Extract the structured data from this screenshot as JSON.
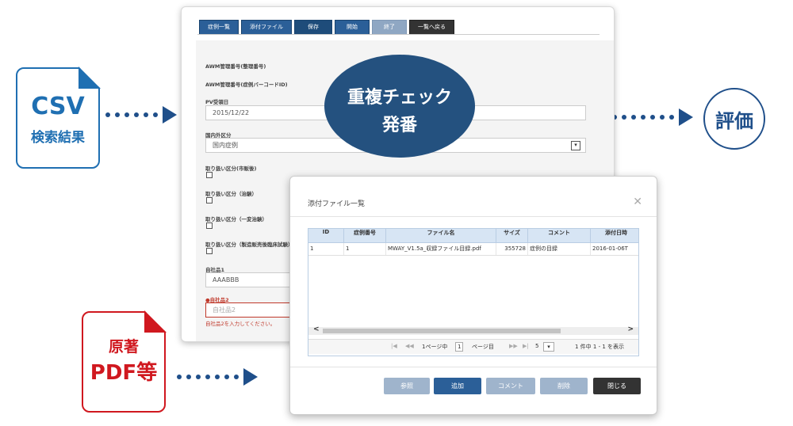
{
  "csv_doc": {
    "title": "CSV",
    "subtitle": "検索結果"
  },
  "pdf_doc": {
    "line1": "原著",
    "line2": "PDF等"
  },
  "eval_label": "評価",
  "ellipse": {
    "line1": "重複チェック",
    "line2": "発番"
  },
  "colors": {
    "brand_blue": "#1f4f8a",
    "pdf_red": "#d0181f",
    "ellipse": "#24517f"
  },
  "main_window": {
    "tabs": [
      "症例一覧",
      "添付ファイル",
      "保存",
      "開始",
      "終了",
      "一覧へ戻る"
    ],
    "fields": {
      "awm_mgmt_label": "AWM管理番号(整理番号)",
      "awm_barcode_label": "AWM管理番号(症例バーコードID)",
      "pv_date_label": "PV受領日",
      "pv_date_value": "2015/12/22",
      "domestic_label": "国内外区分",
      "domestic_value": "国内症例",
      "handling1_label": "取り扱い区分(市販後)",
      "handling2_label": "取り扱い区分（治験）",
      "handling3_label": "取り扱い区分（一変治験）",
      "handling4_label": "取り扱い区分（製造販売後臨床試験）",
      "product1_label": "自社品1",
      "product1_value": "AAABBB",
      "product2_label": "自社品2",
      "product2_placeholder": "自社品2",
      "product2_error": "自社品2を入力してください。"
    }
  },
  "dialog": {
    "title": "添付ファイル一覧",
    "columns": [
      "ID",
      "症例番号",
      "ファイル名",
      "サイズ",
      "コメント",
      "添付日時"
    ],
    "rows": [
      [
        "1",
        "1",
        "MWAY_V1.5a_収録ファイル目録.pdf",
        "355728",
        "症例の目録",
        "2016-01-06T"
      ]
    ],
    "pager": {
      "page_of": "1ページ中",
      "page_num": "1",
      "page_suffix": "ページ目",
      "per_page": "5",
      "summary": "1 件中 1 - 1 を表示"
    },
    "buttons": [
      "参照",
      "追加",
      "コメント",
      "削除",
      "閉じる"
    ]
  }
}
